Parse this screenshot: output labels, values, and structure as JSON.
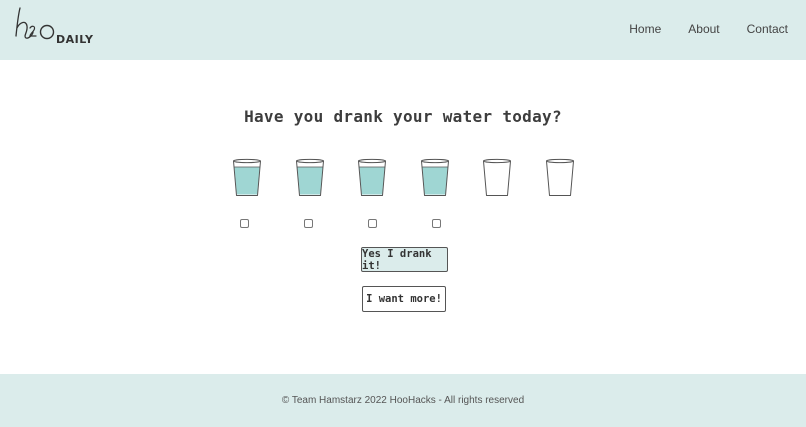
{
  "header": {
    "logo_text": "DAILY",
    "nav": [
      {
        "label": "Home"
      },
      {
        "label": "About"
      },
      {
        "label": "Contact"
      }
    ]
  },
  "main": {
    "title": "Have you drank your water today?",
    "glasses": [
      {
        "filled": true
      },
      {
        "filled": true
      },
      {
        "filled": true
      },
      {
        "filled": true
      },
      {
        "filled": false
      },
      {
        "filled": false
      }
    ],
    "checkbox_count": 4,
    "drank_button": "Yes I drank it!",
    "more_button": "I want more!"
  },
  "footer": {
    "copyright": "© Team Hamstarz 2022 HooHacks - All rights reserved"
  },
  "colors": {
    "accent": "#dbeceb",
    "water": "#9fd6d3",
    "glass_stroke": "#555555"
  }
}
